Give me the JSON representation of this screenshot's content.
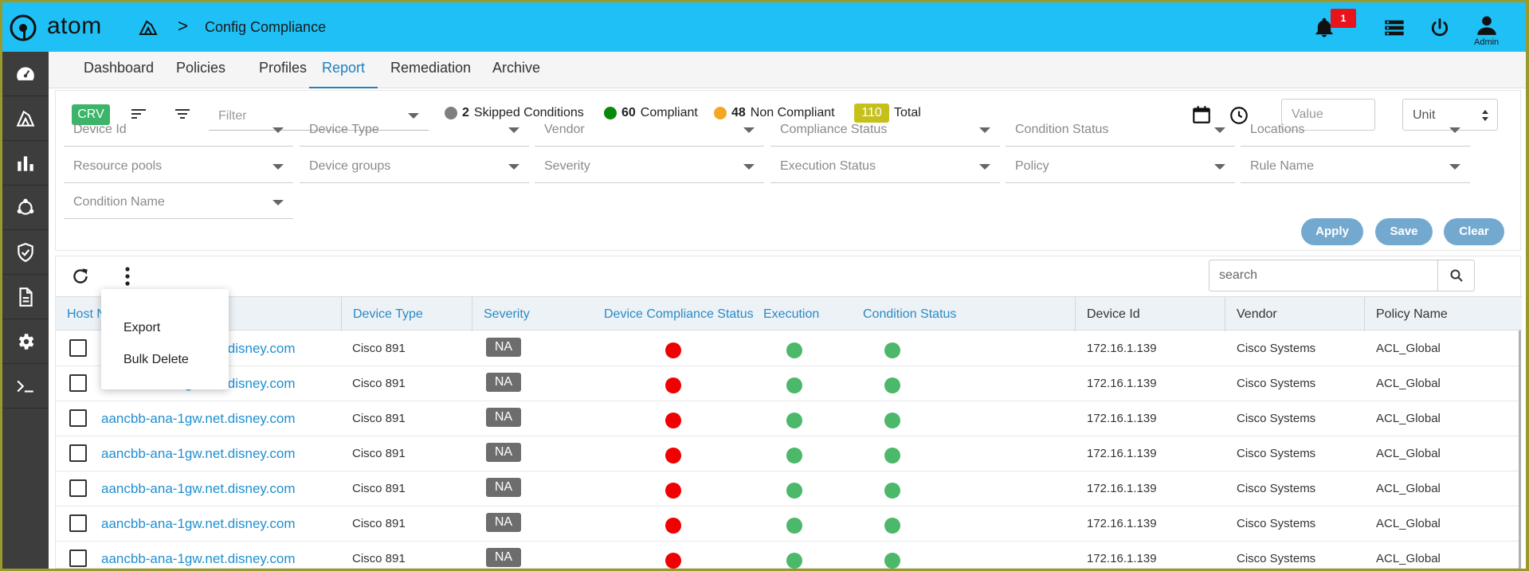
{
  "app": {
    "brand": "atom",
    "breadcrumb_sep": ">",
    "page_title": "Config Compliance",
    "notifications_count": "1",
    "user_label": "Admin"
  },
  "sidebar": {
    "items": [
      {
        "icon": "dashboard-gauge-icon"
      },
      {
        "icon": "compliance-module-icon"
      },
      {
        "icon": "bar-chart-icon"
      },
      {
        "icon": "network-topology-icon"
      },
      {
        "icon": "shield-check-icon"
      },
      {
        "icon": "document-icon"
      },
      {
        "icon": "gear-icon"
      },
      {
        "icon": "terminal-icon"
      }
    ]
  },
  "tabs": [
    {
      "label": "Dashboard",
      "active": false
    },
    {
      "label": "Policies",
      "active": false
    },
    {
      "label": "Profiles",
      "active": false
    },
    {
      "label": "Report",
      "active": true
    },
    {
      "label": "Remediation",
      "active": false
    },
    {
      "label": "Archive",
      "active": false
    }
  ],
  "toolbar": {
    "crv_label": "CRV",
    "filter_placeholder": "Filter",
    "skipped_count": "2",
    "skipped_label": "Skipped Conditions",
    "compliant_count": "60",
    "compliant_label": "Compliant",
    "noncompliant_count": "48",
    "noncompliant_label": "Non Compliant",
    "total_count": "110",
    "total_label": "Total",
    "value_placeholder": "Value",
    "unit_label": "Unit",
    "colors": {
      "skipped": "#7f7f7f",
      "compliant": "#0a8a0a",
      "noncompliant": "#f5a623",
      "total": "#c6c01a"
    }
  },
  "filters": {
    "row1": [
      "Device Id",
      "Device Type",
      "Vendor",
      "Compliance Status",
      "Condition Status",
      "Locations"
    ],
    "row2": [
      "Resource pools",
      "Device groups",
      "Severity",
      "Execution Status",
      "Policy",
      "Rule Name"
    ],
    "row3": [
      "Condition Name"
    ],
    "apply_label": "Apply",
    "save_label": "Save",
    "clear_label": "Clear"
  },
  "grid": {
    "search_placeholder": "search",
    "columns": [
      "Host N",
      "Device Type",
      "Severity",
      "Device Compliance Status",
      "Execution",
      "Condition Status",
      "Device Id",
      "Vendor",
      "Policy Name"
    ],
    "rows": [
      {
        "host": "aancbb-ana-1gw.net.disney.com",
        "device_type": "Cisco 891",
        "severity": "NA",
        "compliance": "red",
        "execution": "green",
        "condition": "green",
        "device_id": "172.16.1.139",
        "vendor": "Cisco Systems",
        "policy": "ACL_Global"
      },
      {
        "host": "aancbb-ana-1gw.net.disney.com",
        "device_type": "Cisco 891",
        "severity": "NA",
        "compliance": "red",
        "execution": "green",
        "condition": "green",
        "device_id": "172.16.1.139",
        "vendor": "Cisco Systems",
        "policy": "ACL_Global"
      },
      {
        "host": "aancbb-ana-1gw.net.disney.com",
        "device_type": "Cisco 891",
        "severity": "NA",
        "compliance": "red",
        "execution": "green",
        "condition": "green",
        "device_id": "172.16.1.139",
        "vendor": "Cisco Systems",
        "policy": "ACL_Global"
      },
      {
        "host": "aancbb-ana-1gw.net.disney.com",
        "device_type": "Cisco 891",
        "severity": "NA",
        "compliance": "red",
        "execution": "green",
        "condition": "green",
        "device_id": "172.16.1.139",
        "vendor": "Cisco Systems",
        "policy": "ACL_Global"
      },
      {
        "host": "aancbb-ana-1gw.net.disney.com",
        "device_type": "Cisco 891",
        "severity": "NA",
        "compliance": "red",
        "execution": "green",
        "condition": "green",
        "device_id": "172.16.1.139",
        "vendor": "Cisco Systems",
        "policy": "ACL_Global"
      },
      {
        "host": "aancbb-ana-1gw.net.disney.com",
        "device_type": "Cisco 891",
        "severity": "NA",
        "compliance": "red",
        "execution": "green",
        "condition": "green",
        "device_id": "172.16.1.139",
        "vendor": "Cisco Systems",
        "policy": "ACL_Global"
      },
      {
        "host": "aancbb-ana-1gw.net.disney.com",
        "device_type": "Cisco 891",
        "severity": "NA",
        "compliance": "red",
        "execution": "green",
        "condition": "green",
        "device_id": "172.16.1.139",
        "vendor": "Cisco Systems",
        "policy": "ACL_Global"
      }
    ]
  },
  "context_menu": {
    "items": [
      "Export",
      "Bulk Delete"
    ]
  }
}
